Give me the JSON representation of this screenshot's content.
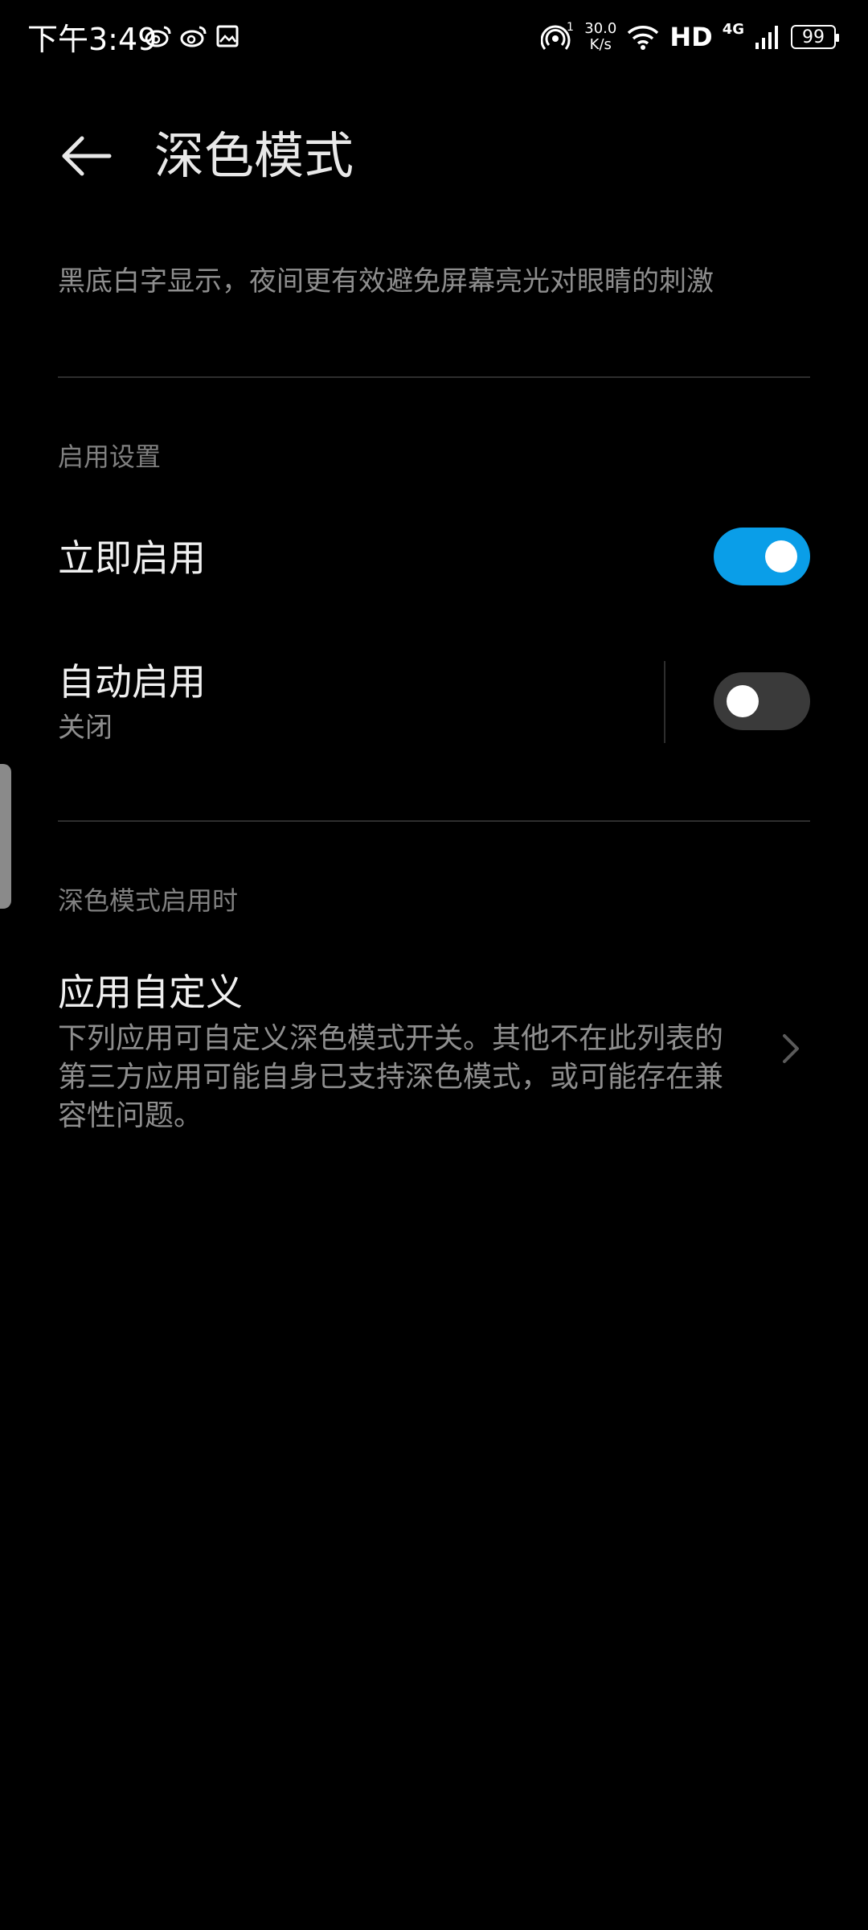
{
  "status_bar": {
    "time": "下午3:49",
    "icons_left": [
      "weibo-icon",
      "weibo-icon",
      "gallery-icon"
    ],
    "speed_value": "30.0",
    "speed_unit": "K/s",
    "hd_label": "HD",
    "network_label": "4G",
    "battery_level": "99",
    "hotspot_count": "1"
  },
  "header": {
    "title": "深色模式",
    "back_icon": "arrow-left-icon"
  },
  "description": "黑底白字显示，夜间更有效避免屏幕亮光对眼睛的刺激",
  "sections": {
    "enable_settings": {
      "label": "启用设置",
      "enable_now": {
        "title": "立即启用",
        "state": "on"
      },
      "auto_enable": {
        "title": "自动启用",
        "subtitle": "关闭",
        "state": "off"
      }
    },
    "when_enabled": {
      "label": "深色模式启用时",
      "app_custom": {
        "title": "应用自定义",
        "description": "下列应用可自定义深色模式开关。其他不在此列表的第三方应用可能自身已支持深色模式，或可能存在兼容性问题。"
      }
    }
  },
  "colors": {
    "background": "#000000",
    "accent": "#0a9ee8",
    "toggle_off": "#3a3a3a",
    "secondary_text": "#8e8e8e"
  }
}
